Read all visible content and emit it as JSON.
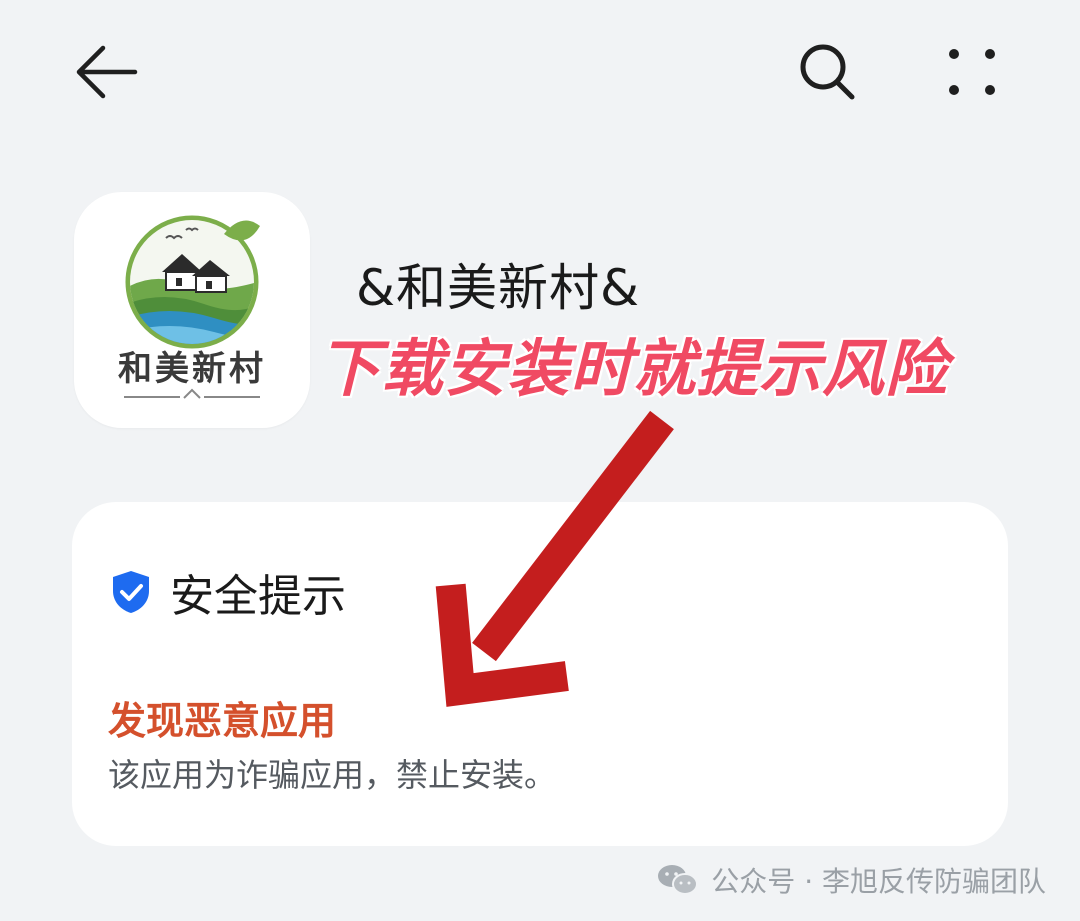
{
  "app": {
    "name": "&和美新村&",
    "logo_text": "和美新村"
  },
  "annotation": {
    "text": "下载安装时就提示风险"
  },
  "security_card": {
    "title": "安全提示",
    "warning_title": "发现恶意应用",
    "warning_desc": "该应用为诈骗应用，禁止安装。"
  },
  "watermark": {
    "text": "公众号 · 李旭反传防骗团队"
  },
  "icons": {
    "back": "back-arrow-icon",
    "search": "search-icon",
    "more": "more-dots-icon",
    "shield": "shield-check-icon",
    "wechat": "wechat-icon"
  },
  "colors": {
    "background": "#f1f3f5",
    "card": "#ffffff",
    "warning": "#d4502c",
    "annotation": "#f04a63",
    "arrow": "#c41e1e",
    "shield": "#1e6bf0"
  }
}
